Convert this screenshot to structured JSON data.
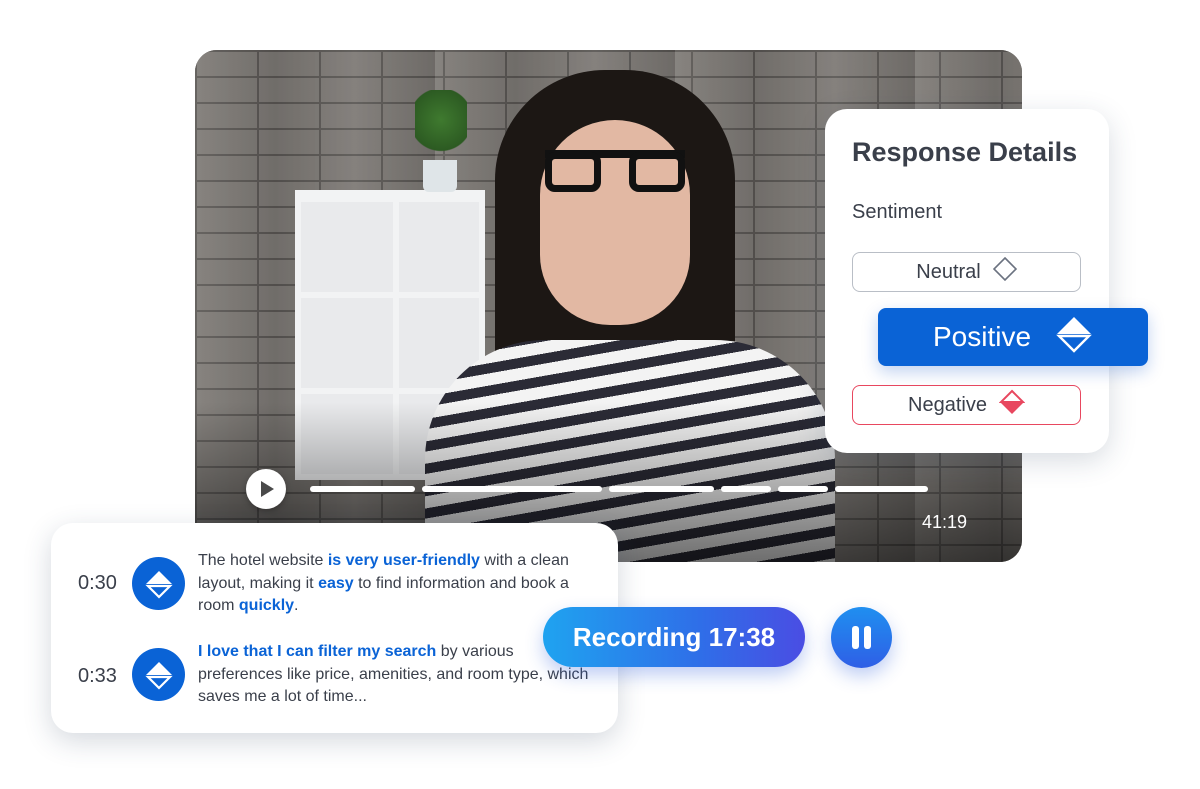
{
  "video": {
    "time": "41:19",
    "progress_segments": [
      0.17,
      0.29,
      0.17,
      0.08,
      0.08,
      0.15
    ]
  },
  "details": {
    "title": "Response Details",
    "sentiment_label": "Sentiment",
    "options": {
      "neutral": "Neutral",
      "positive": "Positive",
      "negative": "Negative"
    },
    "selected": "Positive"
  },
  "transcript": [
    {
      "time": "0:30",
      "parts": [
        {
          "text": "The hotel website ",
          "hl": false
        },
        {
          "text": "is very user-friendly",
          "hl": true
        },
        {
          "text": " with a clean layout, making it ",
          "hl": false
        },
        {
          "text": "easy",
          "hl": true
        },
        {
          "text": " to find information and book a room ",
          "hl": false
        },
        {
          "text": "quickly",
          "hl": true
        },
        {
          "text": ".",
          "hl": false
        }
      ]
    },
    {
      "time": "0:33",
      "parts": [
        {
          "text": "I love that I can filter my search",
          "hl": true
        },
        {
          "text": " by various preferences like price, amenities, and room type, which saves me a lot of time...",
          "hl": false
        }
      ]
    }
  ],
  "recording": {
    "label": "Recording 17:38"
  },
  "colors": {
    "accent": "#0a63d6",
    "negative": "#e8475f",
    "text": "#3a3f4a"
  }
}
